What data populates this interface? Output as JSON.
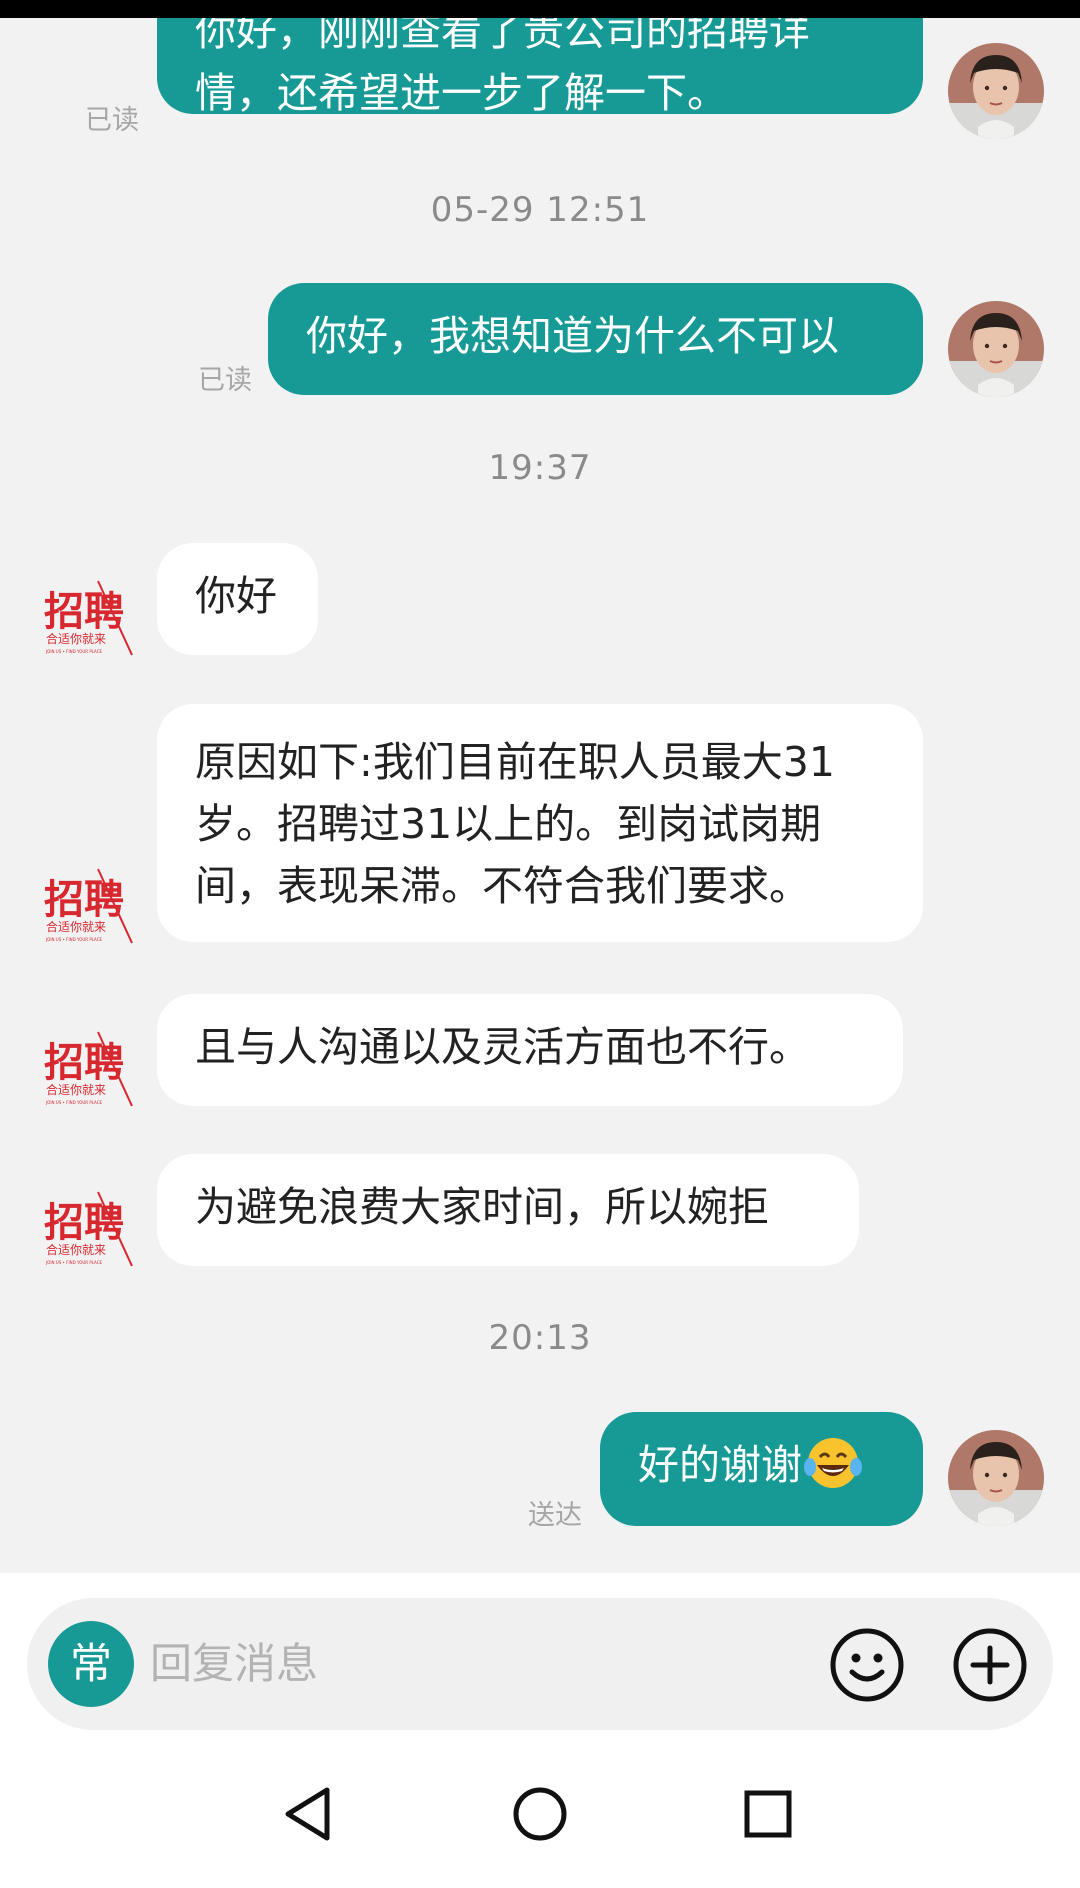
{
  "messages": {
    "m1": {
      "line1": "你好，刚刚查看了贵公司的招聘详",
      "line2": "情，还希望进一步了解一下。",
      "status": "已读"
    },
    "ts1": "05-29 12:51",
    "m2": {
      "text": "你好，我想知道为什么不可以",
      "status": "已读"
    },
    "ts2": "19:37",
    "r1": {
      "text": "你好"
    },
    "r2": {
      "line1": "原因如下:我们目前在职人员最大31",
      "line2": "岁。招聘过31以上的。到岗试岗期",
      "line3": "间，表现呆滞。不符合我们要求。"
    },
    "r3": {
      "text": "且与人沟通以及灵活方面也不行。"
    },
    "r4": {
      "text": "为避免浪费大家时间，所以婉拒"
    },
    "ts3": "20:13",
    "m3": {
      "text": "好的谢谢",
      "emoji": "laughing-tears-emoji",
      "status": "送达"
    }
  },
  "recruiter_logo": {
    "title": "招聘",
    "subtitle": "合适你就来",
    "tagline": "JOIN US • FIND YOUR PLACE",
    "color": "#d8282f"
  },
  "composer": {
    "quick_label": "常",
    "placeholder": "回复消息",
    "emoji_icon": "smiley-icon",
    "plus_icon": "plus-circle-icon"
  },
  "navbar": {
    "back_icon": "triangle-back-icon",
    "home_icon": "circle-home-icon",
    "recents_icon": "square-recents-icon"
  },
  "colors": {
    "outgoing_bubble": "#179a96",
    "incoming_bubble": "#ffffff",
    "background": "#f2f2f2"
  }
}
